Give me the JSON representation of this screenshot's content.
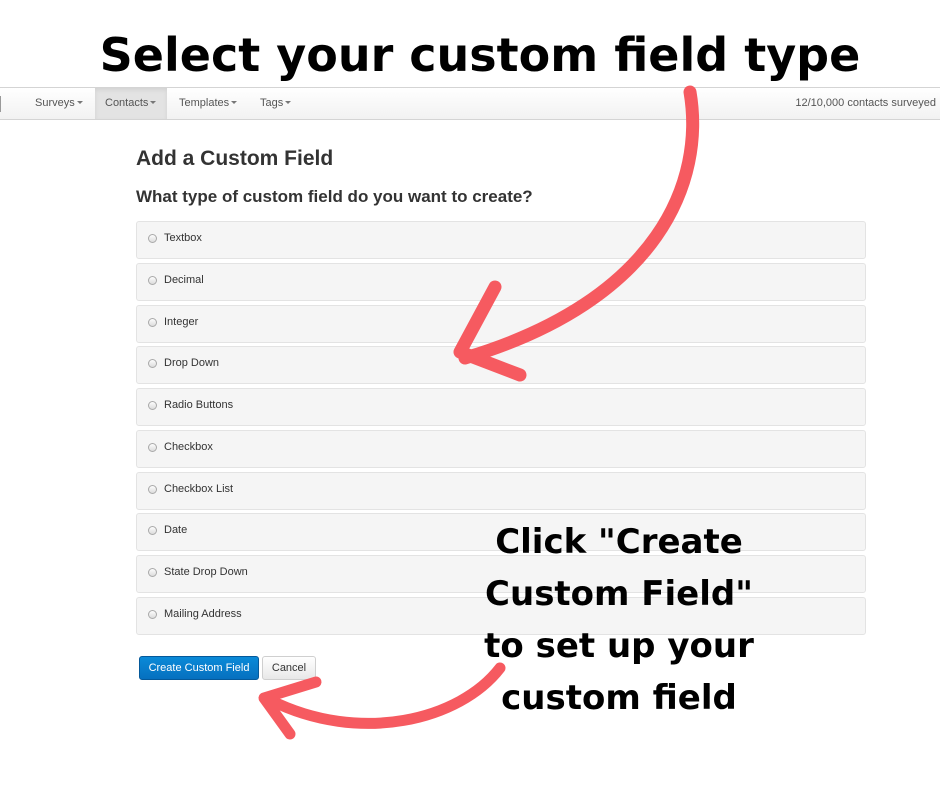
{
  "annotations": {
    "headline": "Select your custom field type",
    "callout": "Click \"Create Custom Field\" to set up your custom field"
  },
  "navbar": {
    "items": [
      {
        "label": "Surveys",
        "active": false
      },
      {
        "label": "Contacts",
        "active": true
      },
      {
        "label": "Templates",
        "active": false
      },
      {
        "label": "Tags",
        "active": false
      }
    ],
    "contacts_surveyed": "12/10,000 contacts surveyed"
  },
  "page": {
    "title": "Add a Custom Field",
    "question": "What type of custom field do you want to create?"
  },
  "field_types": [
    {
      "label": "Textbox",
      "selected": false
    },
    {
      "label": "Decimal",
      "selected": false
    },
    {
      "label": "Integer",
      "selected": false
    },
    {
      "label": "Drop Down",
      "selected": false
    },
    {
      "label": "Radio Buttons",
      "selected": false
    },
    {
      "label": "Checkbox",
      "selected": false
    },
    {
      "label": "Checkbox List",
      "selected": false
    },
    {
      "label": "Date",
      "selected": false
    },
    {
      "label": "State Drop Down",
      "selected": false
    },
    {
      "label": "Mailing Address",
      "selected": false
    }
  ],
  "actions": {
    "create_label": "Create Custom Field",
    "cancel_label": "Cancel"
  },
  "colors": {
    "primary_button": "#0a7fd0",
    "arrow": "#f65a60"
  }
}
